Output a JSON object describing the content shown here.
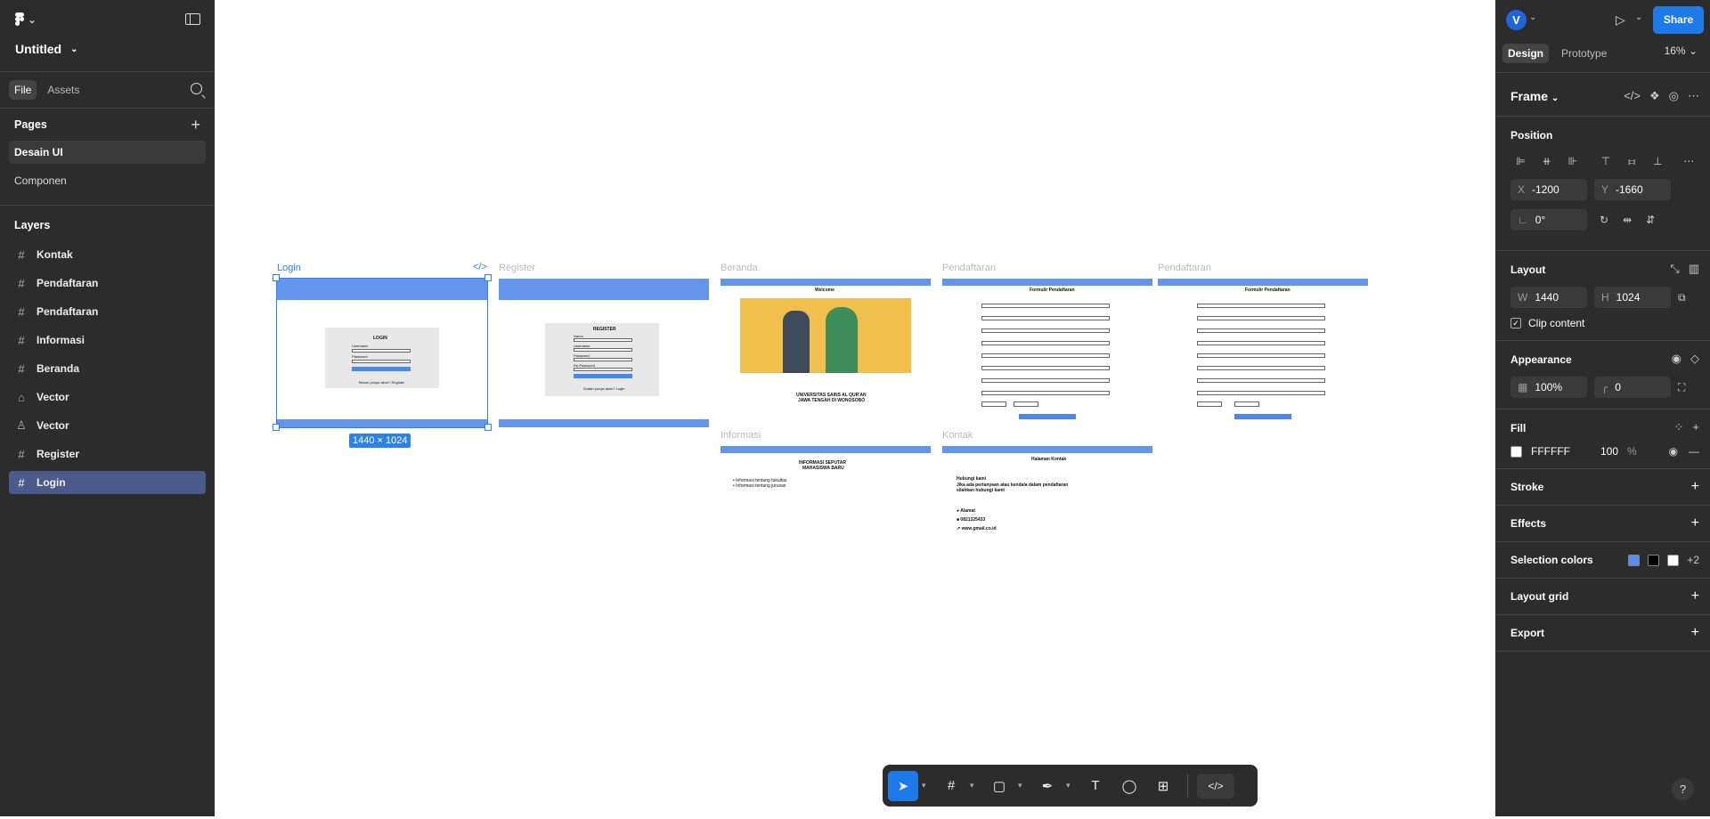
{
  "file": {
    "name": "Untitled"
  },
  "left": {
    "tabs": [
      "File",
      "Assets"
    ],
    "pages_title": "Pages",
    "pages": [
      "Desain UI",
      "Componen"
    ],
    "layers_title": "Layers",
    "layers": [
      {
        "name": "Kontak",
        "icon": "frame-icon"
      },
      {
        "name": "Pendaftaran",
        "icon": "frame-icon"
      },
      {
        "name": "Pendaftaran",
        "icon": "frame-icon"
      },
      {
        "name": "Informasi",
        "icon": "frame-icon"
      },
      {
        "name": "Beranda",
        "icon": "frame-icon"
      },
      {
        "name": "Vector",
        "icon": "vector-icon"
      },
      {
        "name": "Vector",
        "icon": "vector-icon"
      },
      {
        "name": "Register",
        "icon": "frame-icon"
      },
      {
        "name": "Login",
        "icon": "frame-icon"
      }
    ]
  },
  "canvas": {
    "frames": {
      "login": {
        "label": "Login",
        "title": "LOGIN",
        "f1": "Username",
        "f2": "Password",
        "btn": "Login",
        "foot": "Belum punya akun? Register"
      },
      "register": {
        "label": "Register",
        "title": "REGISTER",
        "f1": "Nama",
        "f2": "Username",
        "f3": "Password",
        "f4": "Re-Password",
        "btn": "Register",
        "foot": "Sudah punya akun? Login"
      },
      "beranda": {
        "label": "Beranda",
        "title": "Welcome",
        "line1": "UNIVERSITAS SAINS AL QUR'AN",
        "line2": "JAWA TENGAH DI WONOSOBO"
      },
      "pendaftaran1": {
        "label": "Pendaftaran",
        "title": "Formulir Pendaftaran"
      },
      "pendaftaran2": {
        "label": "Pendaftaran",
        "title": "Formulir Pendaftaran"
      },
      "informasi": {
        "label": "Informasi",
        "title1": "INFORMASI SEPUTAR",
        "title2": "MAHASISWA BARU",
        "b1": "Informasi tentang fakultas",
        "b2": "Informasi tentang jurusan"
      },
      "kontak": {
        "label": "Kontak",
        "title": "Halaman Kontak",
        "h": "Hubungi kami",
        "p1": "Jika ada pertanyaan atau kendala dalam pendaftaran",
        "p2": "silahkan hubungi kami",
        "addr": "Alamat",
        "phone": "0821325433",
        "web": "www.gmail.co.id"
      }
    },
    "selection_size": "1440 × 1024"
  },
  "right": {
    "avatar": "V",
    "share": "Share",
    "tabs": [
      "Design",
      "Prototype"
    ],
    "zoom": "16%",
    "frame_type": "Frame",
    "position": {
      "title": "Position",
      "x": "-1200",
      "y": "-1660",
      "rotation": "0°"
    },
    "layout": {
      "title": "Layout",
      "w": "1440",
      "h": "1024",
      "clip": "Clip content"
    },
    "appearance": {
      "title": "Appearance",
      "opacity": "100%",
      "radius": "0"
    },
    "fill": {
      "title": "Fill",
      "hex": "FFFFFF",
      "opacity": "100",
      "pct": "%"
    },
    "stroke": "Stroke",
    "effects": "Effects",
    "selection_colors": {
      "title": "Selection colors",
      "colors": [
        "#5b8def",
        "#000000",
        "#ffffff"
      ],
      "more": "+2"
    },
    "layout_grid": "Layout grid",
    "export": "Export"
  },
  "colors": {
    "accent": "#1e7ae8",
    "frame_bar": "#6495ed",
    "panel": "#2c2c2c"
  }
}
